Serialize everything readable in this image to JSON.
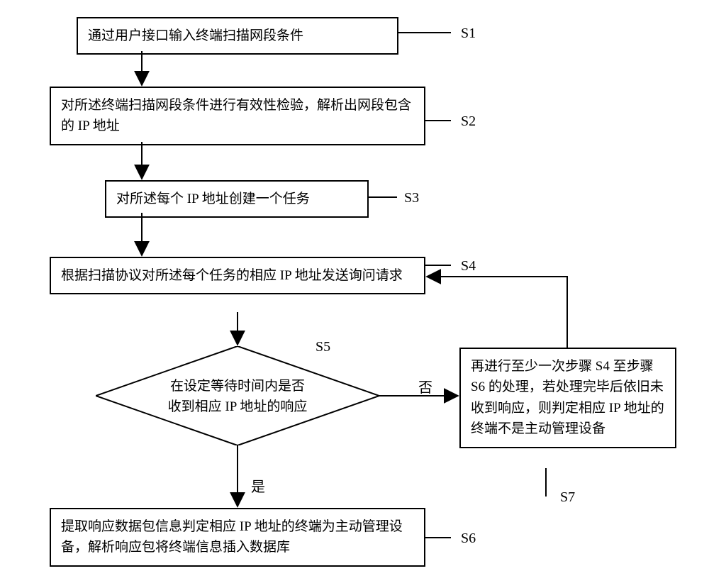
{
  "chart_data": {
    "type": "flowchart",
    "nodes": [
      {
        "id": "S1",
        "shape": "process",
        "text": "通过用户接口输入终端扫描网段条件"
      },
      {
        "id": "S2",
        "shape": "process",
        "text": "对所述终端扫描网段条件进行有效性检验，解析出网段包含的 IP 地址"
      },
      {
        "id": "S3",
        "shape": "process",
        "text": "对所述每个 IP 地址创建一个任务"
      },
      {
        "id": "S4",
        "shape": "process",
        "text": "根据扫描协议对所述每个任务的相应 IP 地址发送询问请求"
      },
      {
        "id": "S5",
        "shape": "decision",
        "text": "在设定等待时间内是否收到相应 IP 地址的响应"
      },
      {
        "id": "S6",
        "shape": "process",
        "text": "提取响应数据包信息判定相应 IP 地址的终端为主动管理设备，解析响应包将终端信息插入数据库"
      },
      {
        "id": "S7",
        "shape": "process",
        "text": "再进行至少一次步骤 S4 至步骤 S6 的处理，若处理完毕后依旧未收到响应，则判定相应 IP 地址的终端不是主动管理设备"
      }
    ],
    "edges": [
      {
        "from": "S1",
        "to": "S2"
      },
      {
        "from": "S2",
        "to": "S3"
      },
      {
        "from": "S3",
        "to": "S4"
      },
      {
        "from": "S4",
        "to": "S5"
      },
      {
        "from": "S5",
        "to": "S6",
        "label": "是"
      },
      {
        "from": "S5",
        "to": "S7",
        "label": "否"
      },
      {
        "from": "S7",
        "to": "S4"
      }
    ]
  },
  "boxes": {
    "s1_text": "通过用户接口输入终端扫描网段条件",
    "s2_text": "对所述终端扫描网段条件进行有效性检验，解析出网段包含的 IP 地址",
    "s3_text": "对所述每个 IP 地址创建一个任务",
    "s4_text": "根据扫描协议对所述每个任务的相应 IP 地址发送询问请求",
    "s5_line1": "在设定等待时间内是否",
    "s5_line2": "收到相应 IP 地址的响应",
    "s6_text": "提取响应数据包信息判定相应 IP 地址的终端为主动管理设备，解析响应包将终端信息插入数据库",
    "s7_text": "再进行至少一次步骤 S4 至步骤 S6 的处理，若处理完毕后依旧未收到响应，则判定相应 IP 地址的终端不是主动管理设备"
  },
  "labels": {
    "s1": "S1",
    "s2": "S2",
    "s3": "S3",
    "s4": "S4",
    "s5": "S5",
    "s6": "S6",
    "s7": "S7",
    "yes": "是",
    "no": "否"
  }
}
